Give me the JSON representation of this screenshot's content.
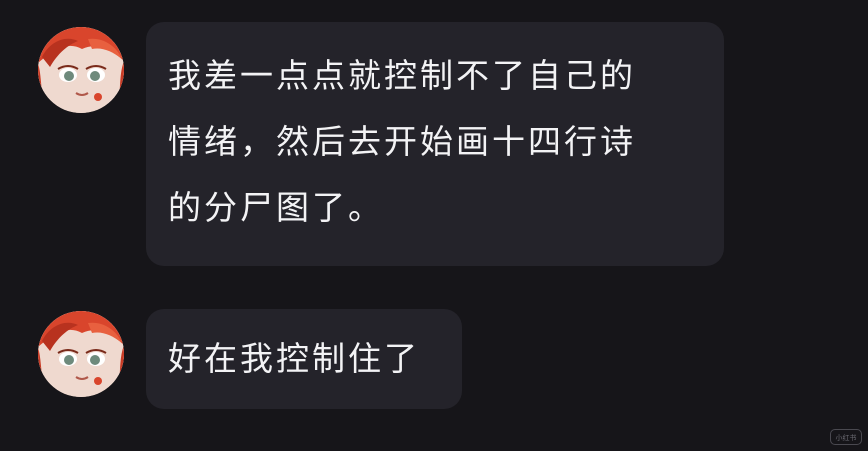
{
  "messages": [
    {
      "lines": [
        "我差一点点就控制不了自己的",
        "情绪，然后去开始画十四行诗",
        "的分尸图了。"
      ]
    },
    {
      "lines": [
        "好在我控制住了"
      ]
    }
  ],
  "watermark": "小红书",
  "colors": {
    "background": "#161519",
    "bubble": "#24232a",
    "text": "#f3f3f5",
    "avatar_hair": "#d9452c",
    "avatar_skin": "#f2dcd2"
  }
}
